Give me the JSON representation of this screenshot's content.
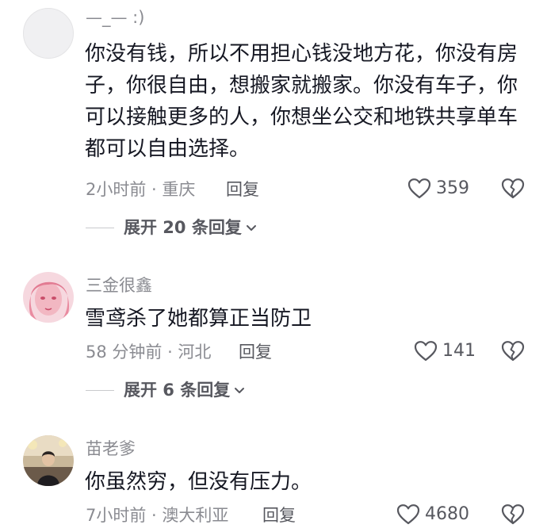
{
  "comments": [
    {
      "username": "—_— :)",
      "text": "你没有钱，所以不用担心钱没地方花，你没有房子，你很自由，想搬家就搬家。你没有车子，你可以接触更多的人，你想坐公交和地铁共享单车都可以自由选择。",
      "meta": "2小时前 · 重庆",
      "reply_label": "回复",
      "likes": "359",
      "expand_label": "展开 20 条回复"
    },
    {
      "username": "三金很鑫",
      "text": "雪鸢杀了她都算正当防卫",
      "meta": "58 分钟前 · 河北",
      "reply_label": "回复",
      "likes": "141",
      "expand_label": "展开 6 条回复"
    },
    {
      "username": "苗老爹",
      "text": "你虽然穷，但没有压力。",
      "meta": "7小时前 · 澳大利亚",
      "reply_label": "回复",
      "likes": "4680"
    }
  ],
  "icons": {
    "like": "heart-outline-icon",
    "dislike": "broken-heart-icon",
    "expand": "chevron-down-icon"
  },
  "colors": {
    "text": "#161823",
    "secondary": "#8a8b91",
    "action": "#57585f"
  }
}
